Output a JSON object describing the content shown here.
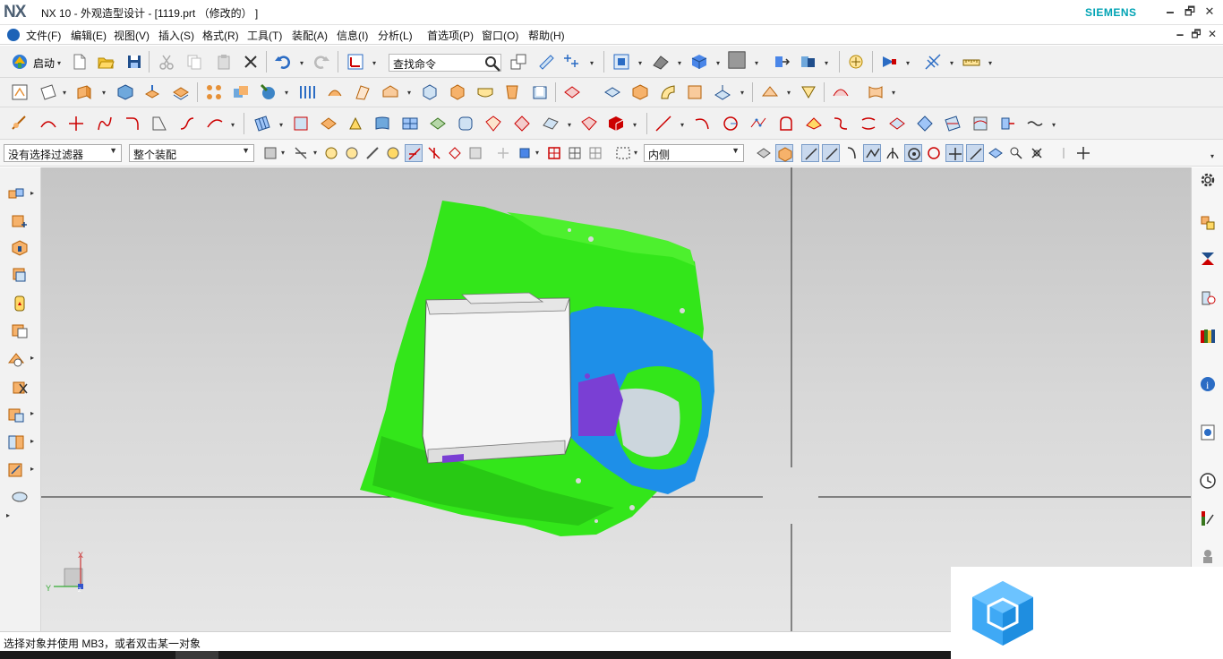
{
  "titlebar": {
    "logo": "NX",
    "title": "NX 10 - 外观造型设计 - [1119.prt （修改的） ]",
    "brand": "SIEMENS",
    "minimize": "🗕",
    "restore": "🗗",
    "close": "✕"
  },
  "menubar": {
    "items": [
      "文件(F)",
      "编辑(E)",
      "视图(V)",
      "插入(S)",
      "格式(R)",
      "工具(T)",
      "装配(A)",
      "信息(I)",
      "分析(L)",
      "首选项(P)",
      "窗口(O)",
      "帮助(H)"
    ],
    "doc_minimize": "🗕",
    "doc_restore": "🗗",
    "doc_close": "✕"
  },
  "toolbar": {
    "start_label": "启动",
    "command_search_placeholder": "查找命令"
  },
  "selection_bar": {
    "filter_value": "没有选择过滤器",
    "scope_value": "整个装配",
    "inside_value": "内侧"
  },
  "viewport": {
    "triad": {
      "x_label": "X",
      "y_label": "Y",
      "z_label": "Z"
    },
    "colors": {
      "scan_green": "#33e61a",
      "scan_blue": "#1e8fe8",
      "body_white": "#f5f5f5",
      "accent_purple": "#7a3fd4"
    }
  },
  "statusbar": {
    "text": "选择对象并使用 MB3，或者双击某一对象"
  },
  "icons": {
    "left_resource": [
      "assembly-navigator-icon",
      "constraint-navigator-icon",
      "part-navigator-icon",
      "reuse-library-icon",
      "hd3d-tools-icon",
      "web-browser-icon",
      "history-icon",
      "system-materials-icon",
      "process-studio-icon",
      "manufacturing-wizards-icon",
      "roles-icon",
      "system-scenes-icon"
    ],
    "right_resource": [
      "settings-gear-icon",
      "assembly-icon",
      "constraints-icon",
      "part-icon",
      "library-icon",
      "info-icon",
      "web-icon",
      "clock-icon",
      "analysis-icon",
      "role-icon"
    ]
  }
}
